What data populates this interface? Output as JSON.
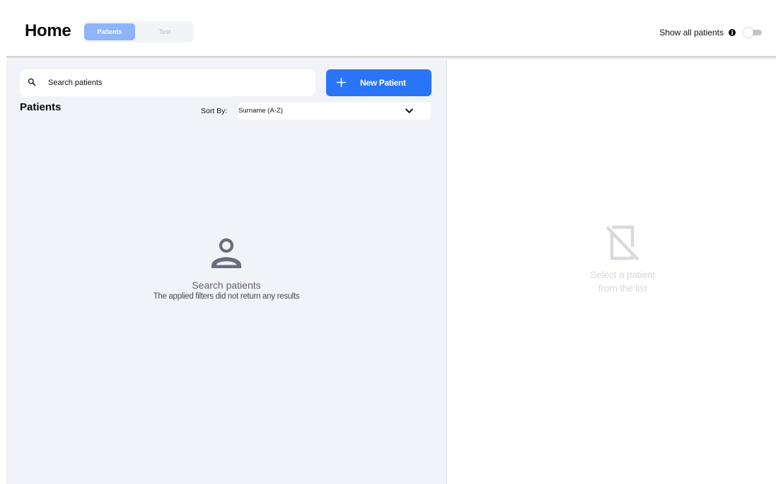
{
  "header": {
    "title": "Home",
    "tabs": [
      {
        "label": "Patients",
        "active": true
      },
      {
        "label": "Test",
        "active": false
      }
    ],
    "show_all_label": "Show all patients",
    "info_icon": "info-icon",
    "show_all_enabled": false
  },
  "patients_panel": {
    "search": {
      "placeholder": "Search patients",
      "value": ""
    },
    "new_patient_label": "New Patient",
    "list_title": "Patients",
    "sort": {
      "label": "Sort By:",
      "selected": "Surname (A-Z)"
    },
    "empty_state": {
      "icon": "person-icon",
      "title": "Search patients",
      "subtitle": "The applied filters did not return any results"
    }
  },
  "detail_panel": {
    "icon": "no-file-icon",
    "message": "Select a patient\nfrom the list"
  },
  "colors": {
    "accent": "#2a74f8",
    "tab_active": "#8eb4fb",
    "panel_bg": "#f2f3f8",
    "muted_text": "#5c6371",
    "placeholder_icon": "#6b7280"
  }
}
